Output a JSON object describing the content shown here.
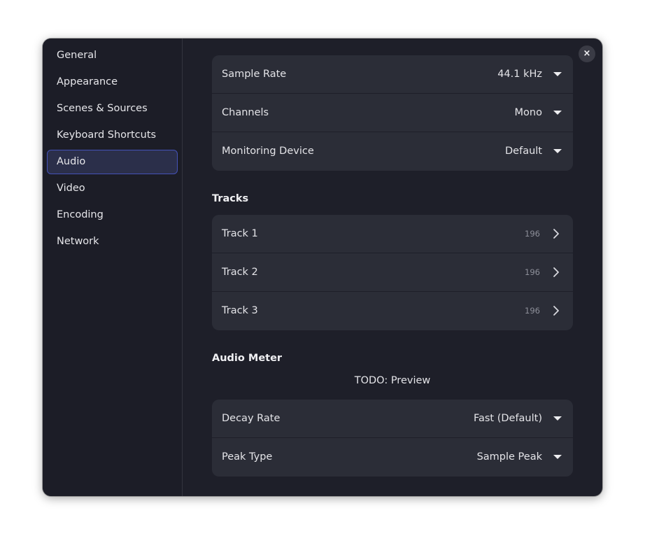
{
  "window": {
    "close_icon": "×"
  },
  "sidebar": {
    "items": [
      {
        "label": "General"
      },
      {
        "label": "Appearance"
      },
      {
        "label": "Scenes & Sources"
      },
      {
        "label": "Keyboard Shortcuts"
      },
      {
        "label": "Audio",
        "active": true
      },
      {
        "label": "Video"
      },
      {
        "label": "Encoding"
      },
      {
        "label": "Network"
      }
    ]
  },
  "audio_settings": {
    "sample_rate": {
      "label": "Sample Rate",
      "value": "44.1 kHz"
    },
    "channels": {
      "label": "Channels",
      "value": "Mono"
    },
    "monitoring_device": {
      "label": "Monitoring Device",
      "value": "Default"
    }
  },
  "tracks": {
    "title": "Tracks",
    "items": [
      {
        "label": "Track 1",
        "count": "196"
      },
      {
        "label": "Track 2",
        "count": "196"
      },
      {
        "label": "Track 3",
        "count": "196"
      }
    ]
  },
  "audio_meter": {
    "title": "Audio Meter",
    "preview_text": "TODO: Preview",
    "decay_rate": {
      "label": "Decay Rate",
      "value": "Fast (Default)"
    },
    "peak_type": {
      "label": "Peak Type",
      "value": "Sample Peak"
    }
  },
  "colors": {
    "window_bg": "#1e1f29",
    "card_bg": "#2b2d37",
    "accent_border": "#4452b8",
    "active_bg": "#2b2f4a"
  }
}
